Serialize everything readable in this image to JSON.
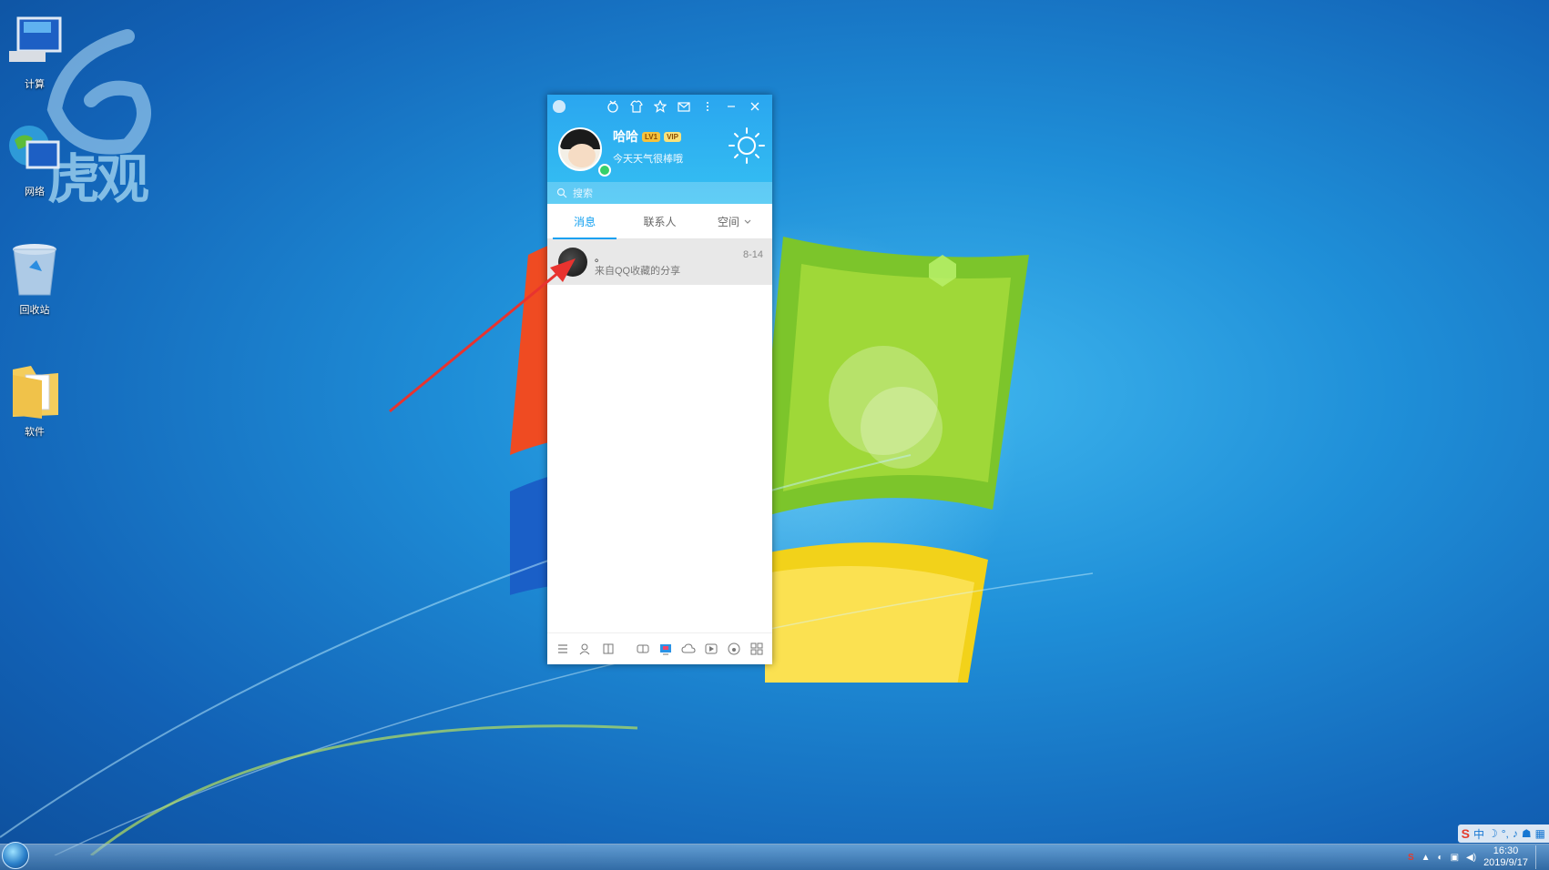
{
  "desktop": {
    "icons": [
      {
        "label": "计算",
        "icon": "computer-icon"
      },
      {
        "label": "网络",
        "icon": "network-globe-icon"
      },
      {
        "label": "回收站",
        "icon": "recycle-bin-icon"
      },
      {
        "label": "软件",
        "icon": "folder-icon"
      }
    ],
    "watermark_text": "虎观"
  },
  "qq": {
    "profile": {
      "nickname": "哈哈",
      "level_badge": "LV1",
      "vip_badge": "VIP",
      "signature": "今天天气很棒哦"
    },
    "search_placeholder": "搜索",
    "tabs": [
      {
        "label": "消息",
        "active": true
      },
      {
        "label": "联系人",
        "active": false
      },
      {
        "label": "空间",
        "active": false
      }
    ],
    "messages": [
      {
        "title": "。",
        "preview": "来自QQ收藏的分享",
        "time": "8-14"
      }
    ],
    "colors": {
      "accent": "#12a0f0",
      "header": "#2aa6f0"
    }
  },
  "taskbar": {
    "time": "16:30",
    "date": "2019/9/17",
    "ime_label": "中"
  }
}
